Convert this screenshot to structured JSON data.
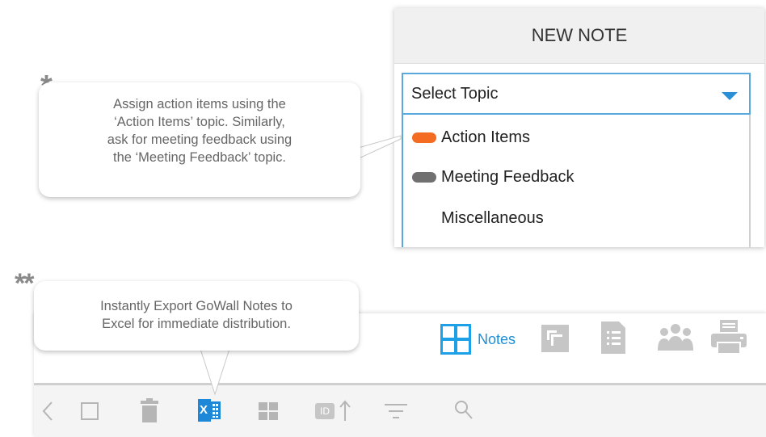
{
  "new_note": {
    "title": "NEW NOTE",
    "select_placeholder": "Select Topic",
    "topics": [
      {
        "label": "Action Items",
        "color": "#f36c21"
      },
      {
        "label": "Meeting Feedback",
        "color": "#707070"
      },
      {
        "label": "Miscellaneous",
        "color": null
      }
    ]
  },
  "callout_topics": {
    "marker": "*",
    "lines": [
      "Assign action items using the",
      "‘Action Items’ topic.  Similarly,",
      "ask for meeting feedback using",
      "the ‘Meeting Feedback’ topic."
    ]
  },
  "callout_export": {
    "marker": "**",
    "lines": [
      "Instantly Export GoWall Notes to",
      "Excel for immediate distribution."
    ]
  },
  "view_bar": {
    "notes_label": "Notes",
    "icons": [
      "notes-grid-icon",
      "stack-icon",
      "list-document-icon",
      "people-icon",
      "printer-icon"
    ],
    "accent": "#1ea0e6"
  },
  "toolbar": {
    "icons": [
      "back-chevron-icon",
      "select-checkbox-icon",
      "trash-icon",
      "excel-export-icon",
      "grid-layout-icon",
      "sort-id-icon",
      "filter-icon",
      "search-icon"
    ],
    "excel_letter": "X",
    "id_label": "ID",
    "excel_color": "#1e88d8"
  }
}
